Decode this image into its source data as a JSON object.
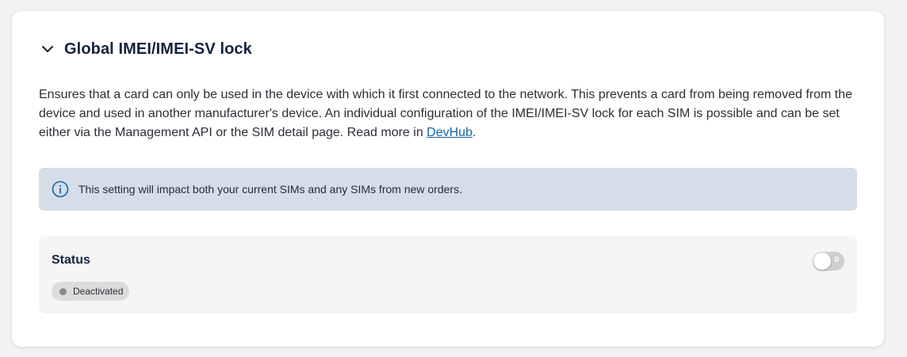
{
  "section": {
    "title": "Global IMEI/IMEI-SV lock",
    "expanded": true,
    "description_before_link": "Ensures that a card can only be used in the device with which it first connected to the network. This prevents a card from being removed from the device and used in another manufacturer's device. An individual configuration of the IMEI/IMEI-SV lock for each SIM is possible and can be set either via the Management API or the SIM detail page. Read more in ",
    "description_link": "DevHub",
    "description_after_link": "."
  },
  "info": {
    "icon": "info-circle-icon",
    "text": "This setting will impact both your current SIMs and any SIMs from new orders."
  },
  "status": {
    "label": "Status",
    "badge_text": "Deactivated",
    "toggle_state_text": "0",
    "enabled": false
  },
  "colors": {
    "info_background": "#d6dde8",
    "info_icon": "#1565a8",
    "link": "#1565a8",
    "badge_background": "#dcdcdc",
    "badge_dot": "#8a8a8a",
    "toggle_off": "#cfcfcf"
  }
}
